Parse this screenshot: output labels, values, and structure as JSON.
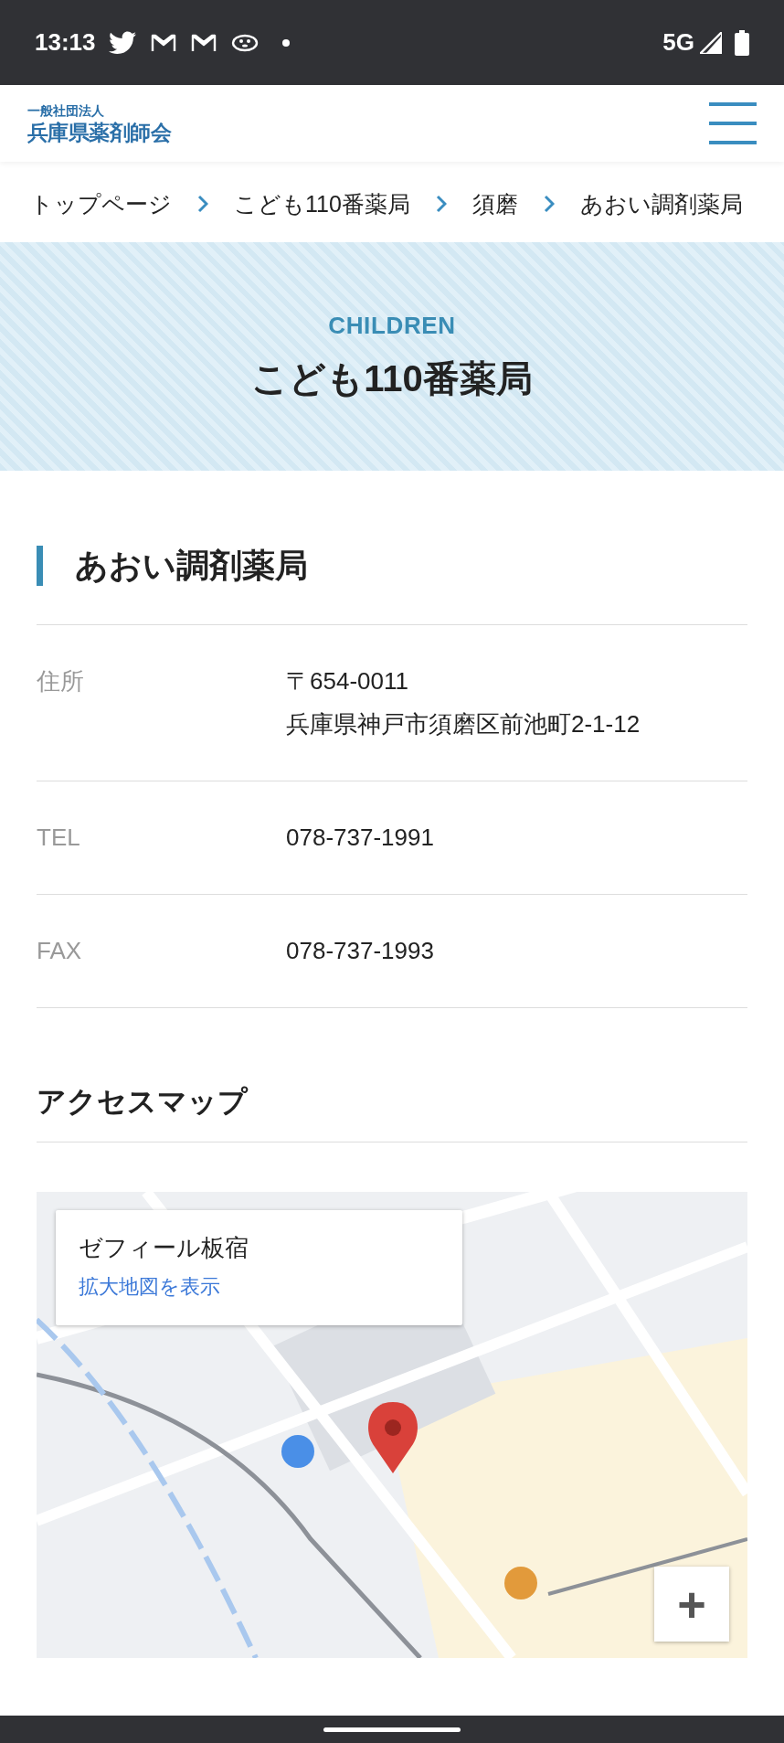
{
  "status_bar": {
    "time": "13:13",
    "network": "5G"
  },
  "header": {
    "org_type": "一般社団法人",
    "org_name": "兵庫県薬剤師会"
  },
  "breadcrumb": [
    "トップページ",
    "こども110番薬局",
    "須磨",
    "あおい調剤薬局"
  ],
  "hero": {
    "eyebrow": "CHILDREN",
    "title": "こども110番薬局"
  },
  "pharmacy": {
    "name": "あおい調剤薬局",
    "details": [
      {
        "label": "住所",
        "lines": [
          "〒654-0011",
          "兵庫県神戸市須磨区前池町2-1-12"
        ]
      },
      {
        "label": "TEL",
        "lines": [
          "078-737-1991"
        ]
      },
      {
        "label": "FAX",
        "lines": [
          "078-737-1993"
        ]
      }
    ]
  },
  "access_map": {
    "heading": "アクセスマップ",
    "info_card": {
      "place": "ゼフィール板宿",
      "link": "拡大地図を表示"
    },
    "zoom_in": "+"
  }
}
